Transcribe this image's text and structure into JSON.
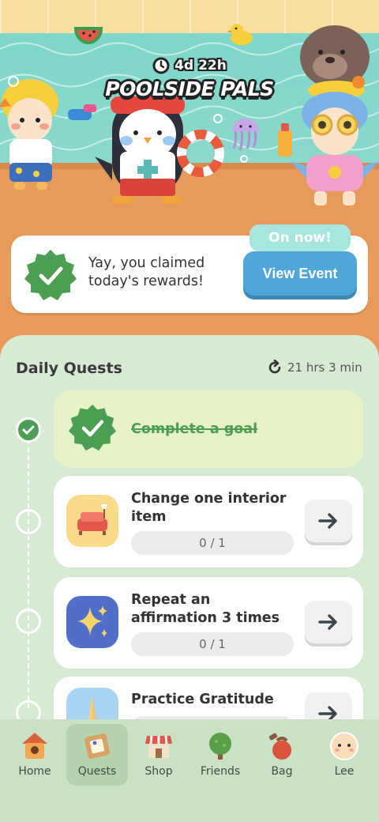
{
  "event": {
    "timer": "4d 22h",
    "title": "POOLSIDE PALS",
    "on_now_label": "On now!",
    "view_event_label": "View Event"
  },
  "claim": {
    "text": "Yay, you claimed today's rewards!"
  },
  "daily_quests": {
    "title": "Daily Quests",
    "refresh_time": "21 hrs 3 min",
    "items": [
      {
        "title": "Complete a goal",
        "completed": true
      },
      {
        "title": "Change one interior item",
        "progress": "0 / 1",
        "icon": "sofa-icon"
      },
      {
        "title": "Repeat an affirmation 3 times",
        "progress": "0 / 1",
        "icon": "sparkle-icon"
      },
      {
        "title": "Practice Gratitude",
        "icon": "praying-hands-icon"
      }
    ]
  },
  "nav": {
    "items": [
      {
        "label": "Home",
        "icon": "birdhouse-icon"
      },
      {
        "label": "Quests",
        "icon": "quest-board-icon",
        "active": true
      },
      {
        "label": "Shop",
        "icon": "shop-icon"
      },
      {
        "label": "Friends",
        "icon": "tree-icon"
      },
      {
        "label": "Bag",
        "icon": "bag-icon"
      },
      {
        "label": "Lee",
        "icon": "avatar-icon"
      }
    ]
  },
  "colors": {
    "accent_green": "#4b9e52",
    "button_blue": "#4fa6d9",
    "panel_green": "#d7ebd3",
    "deck_orange": "#e79a5a"
  }
}
